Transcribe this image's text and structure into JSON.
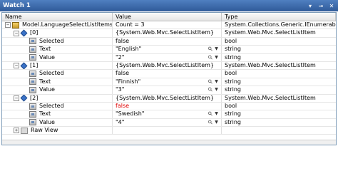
{
  "window": {
    "title": "Watch 1"
  },
  "header": {
    "name": "Name",
    "value": "Value",
    "type": "Type"
  },
  "rows": [
    {
      "indent": 0,
      "expander": "minus",
      "icon": "object",
      "name": "Model.LanguageSelectListItems",
      "value": "Count = 3",
      "type": "System.Collections.Generic.IEnumerable<",
      "changed": false,
      "viz": false
    },
    {
      "indent": 1,
      "expander": "minus",
      "icon": "diamond",
      "name": "[0]",
      "value": "{System.Web.Mvc.SelectListItem}",
      "type": "System.Web.Mvc.SelectListItem",
      "changed": false,
      "viz": false
    },
    {
      "indent": 2,
      "expander": "none",
      "icon": "prop",
      "name": "Selected",
      "value": "false",
      "type": "bool",
      "changed": false,
      "viz": false
    },
    {
      "indent": 2,
      "expander": "none",
      "icon": "prop",
      "name": "Text",
      "value": "\"English\"",
      "type": "string",
      "changed": false,
      "viz": true
    },
    {
      "indent": 2,
      "expander": "none",
      "icon": "prop",
      "name": "Value",
      "value": "\"2\"",
      "type": "string",
      "changed": false,
      "viz": true
    },
    {
      "indent": 1,
      "expander": "minus",
      "icon": "diamond",
      "name": "[1]",
      "value": "{System.Web.Mvc.SelectListItem}",
      "type": "System.Web.Mvc.SelectListItem",
      "changed": false,
      "viz": false
    },
    {
      "indent": 2,
      "expander": "none",
      "icon": "prop",
      "name": "Selected",
      "value": "false",
      "type": "bool",
      "changed": false,
      "viz": false
    },
    {
      "indent": 2,
      "expander": "none",
      "icon": "prop",
      "name": "Text",
      "value": "\"Finnish\"",
      "type": "string",
      "changed": false,
      "viz": true
    },
    {
      "indent": 2,
      "expander": "none",
      "icon": "prop",
      "name": "Value",
      "value": "\"3\"",
      "type": "string",
      "changed": false,
      "viz": true
    },
    {
      "indent": 1,
      "expander": "minus",
      "icon": "diamond",
      "name": "[2]",
      "value": "{System.Web.Mvc.SelectListItem}",
      "type": "System.Web.Mvc.SelectListItem",
      "changed": false,
      "viz": false
    },
    {
      "indent": 2,
      "expander": "none",
      "icon": "prop",
      "name": "Selected",
      "value": "false",
      "type": "bool",
      "changed": true,
      "viz": false
    },
    {
      "indent": 2,
      "expander": "none",
      "icon": "prop",
      "name": "Text",
      "value": "\"Swedish\"",
      "type": "string",
      "changed": false,
      "viz": true
    },
    {
      "indent": 2,
      "expander": "none",
      "icon": "prop",
      "name": "Value",
      "value": "\"4\"",
      "type": "string",
      "changed": false,
      "viz": true
    },
    {
      "indent": 1,
      "expander": "plus",
      "icon": "raw",
      "name": "Raw View",
      "value": "",
      "type": "",
      "changed": false,
      "viz": false
    }
  ],
  "icons": {
    "object": "object-icon",
    "diamond": "field-icon",
    "prop": "property-icon",
    "raw": "raw-view-icon",
    "viz": "magnifier-icon",
    "dropdown": "dropdown-arrow-icon"
  },
  "colors": {
    "title_bar": "#2f5a99",
    "changed_value": "#e00000"
  }
}
